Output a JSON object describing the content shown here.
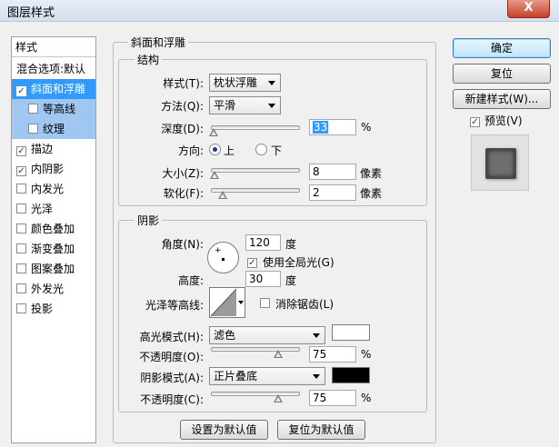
{
  "window": {
    "title": "图层样式",
    "close": "X"
  },
  "sidebar": {
    "items": [
      {
        "label": "样式",
        "checkbox": false,
        "checked": false
      },
      {
        "label": "混合选项:默认",
        "checkbox": false,
        "checked": false
      },
      {
        "label": "斜面和浮雕",
        "checkbox": true,
        "checked": true,
        "selected": true
      },
      {
        "label": "等高线",
        "checkbox": true,
        "checked": false
      },
      {
        "label": "纹理",
        "checkbox": true,
        "checked": false
      },
      {
        "label": "描边",
        "checkbox": true,
        "checked": true
      },
      {
        "label": "内阴影",
        "checkbox": true,
        "checked": true
      },
      {
        "label": "内发光",
        "checkbox": true,
        "checked": false
      },
      {
        "label": "光泽",
        "checkbox": true,
        "checked": false
      },
      {
        "label": "颜色叠加",
        "checkbox": true,
        "checked": false
      },
      {
        "label": "渐变叠加",
        "checkbox": true,
        "checked": false
      },
      {
        "label": "图案叠加",
        "checkbox": true,
        "checked": false
      },
      {
        "label": "外发光",
        "checkbox": true,
        "checked": false
      },
      {
        "label": "投影",
        "checkbox": true,
        "checked": false
      }
    ]
  },
  "bevel": {
    "group_title": "斜面和浮雕",
    "structure": {
      "title": "结构",
      "style_label": "样式(T):",
      "style_value": "枕状浮雕",
      "technique_label": "方法(Q):",
      "technique_value": "平滑",
      "depth_label": "深度(D):",
      "depth_value": "33",
      "depth_unit": "%",
      "depth_slider": 0.03,
      "direction_label": "方向:",
      "direction_up": "上",
      "direction_down": "下",
      "size_label": "大小(Z):",
      "size_value": "8",
      "size_unit": "像素",
      "size_slider": 0.04,
      "soften_label": "软化(F):",
      "soften_value": "2",
      "soften_unit": "像素",
      "soften_slider": 0.13
    },
    "shading": {
      "title": "阴影",
      "angle_label": "角度(N):",
      "angle_value": "120",
      "angle_unit": "度",
      "global_light_label": "使用全局光(G)",
      "altitude_label": "高度:",
      "altitude_value": "30",
      "altitude_unit": "度",
      "gloss_label": "光泽等高线:",
      "antialias_label": "消除锯齿(L)",
      "highlight_mode_label": "高光模式(H):",
      "highlight_mode_value": "滤色",
      "highlight_color": "#ffffff",
      "highlight_opacity_label": "不透明度(O):",
      "highlight_opacity_value": "75",
      "highlight_opacity_unit": "%",
      "highlight_opacity_slider": 0.75,
      "shadow_mode_label": "阴影模式(A):",
      "shadow_mode_value": "正片叠底",
      "shadow_color": "#000000",
      "shadow_opacity_label": "不透明度(C):",
      "shadow_opacity_value": "75",
      "shadow_opacity_unit": "%",
      "shadow_opacity_slider": 0.75
    },
    "make_default": "设置为默认值",
    "reset_default": "复位为默认值"
  },
  "buttons": {
    "ok": "确定",
    "reset": "复位",
    "new_style": "新建样式(W)...",
    "preview_label": "预览(V)"
  }
}
